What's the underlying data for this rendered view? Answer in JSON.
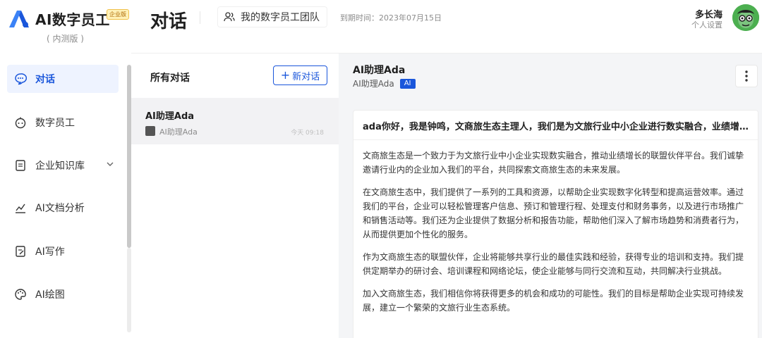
{
  "brand": {
    "title": "AI数字员工",
    "badge": "企业版",
    "subtitle": "( 内测版 )"
  },
  "sidebar": {
    "items": [
      {
        "label": "对话",
        "icon": "chat-bubble-icon",
        "active": true
      },
      {
        "label": "数字员工",
        "icon": "robot-icon"
      },
      {
        "label": "企业知识库",
        "icon": "document-icon",
        "expandable": true
      },
      {
        "label": "AI文档分析",
        "icon": "chart-line-icon"
      },
      {
        "label": "AI写作",
        "icon": "edit-note-icon"
      },
      {
        "label": "AI绘图",
        "icon": "palette-icon"
      }
    ]
  },
  "header": {
    "title": "对话",
    "team_button": "我的数字员工团队",
    "expire_text": "到期时间：2023年07月15日",
    "user_name": "多长海",
    "user_settings": "个人设置"
  },
  "conversations": {
    "title": "所有对话",
    "new_button": "新对话",
    "items": [
      {
        "title": "AI助理Ada",
        "subtitle": "AI助理Ada",
        "time": "今天 09:18"
      }
    ]
  },
  "chat": {
    "title": "AI助理Ada",
    "subtitle": "AI助理Ada",
    "tag": "AI",
    "message_head": "ada你好，我是钟鸣，文商旅生态主理人，我们是为文旅行业中小企业进行数实融合，业绩增...",
    "paragraphs": [
      "文商旅生态是一个致力于为文旅行业中小企业实现数实融合，推动业绩增长的联盟伙伴平台。我们诚挚邀请行业内的企业加入我们的平台，共同探索文商旅生态的未来发展。",
      "在文商旅生态中，我们提供了一系列的工具和资源，以帮助企业实现数字化转型和提高运营效率。通过我们的平台，企业可以轻松管理客户信息、预订和管理行程、处理支付和财务事务，以及进行市场推广和销售活动等。我们还为企业提供了数据分析和报告功能，帮助他们深入了解市场趋势和消费者行为，从而提供更加个性化的服务。",
      "作为文商旅生态的联盟伙伴，企业将能够共享行业的最佳实践和经验，获得专业的培训和支持。我们提供定期举办的研讨会、培训课程和网络论坛，使企业能够与同行交流和互动，共同解决行业挑战。",
      "加入文商旅生态，我们相信你将获得更多的机会和成功的可能性。我们的目标是帮助企业实现可持续发展，建立一个繁荣的文旅行业生态系统。"
    ]
  },
  "colors": {
    "accent": "#1a56db",
    "active_bg": "#eef3ff",
    "chat_bg": "#f4f5f7"
  }
}
